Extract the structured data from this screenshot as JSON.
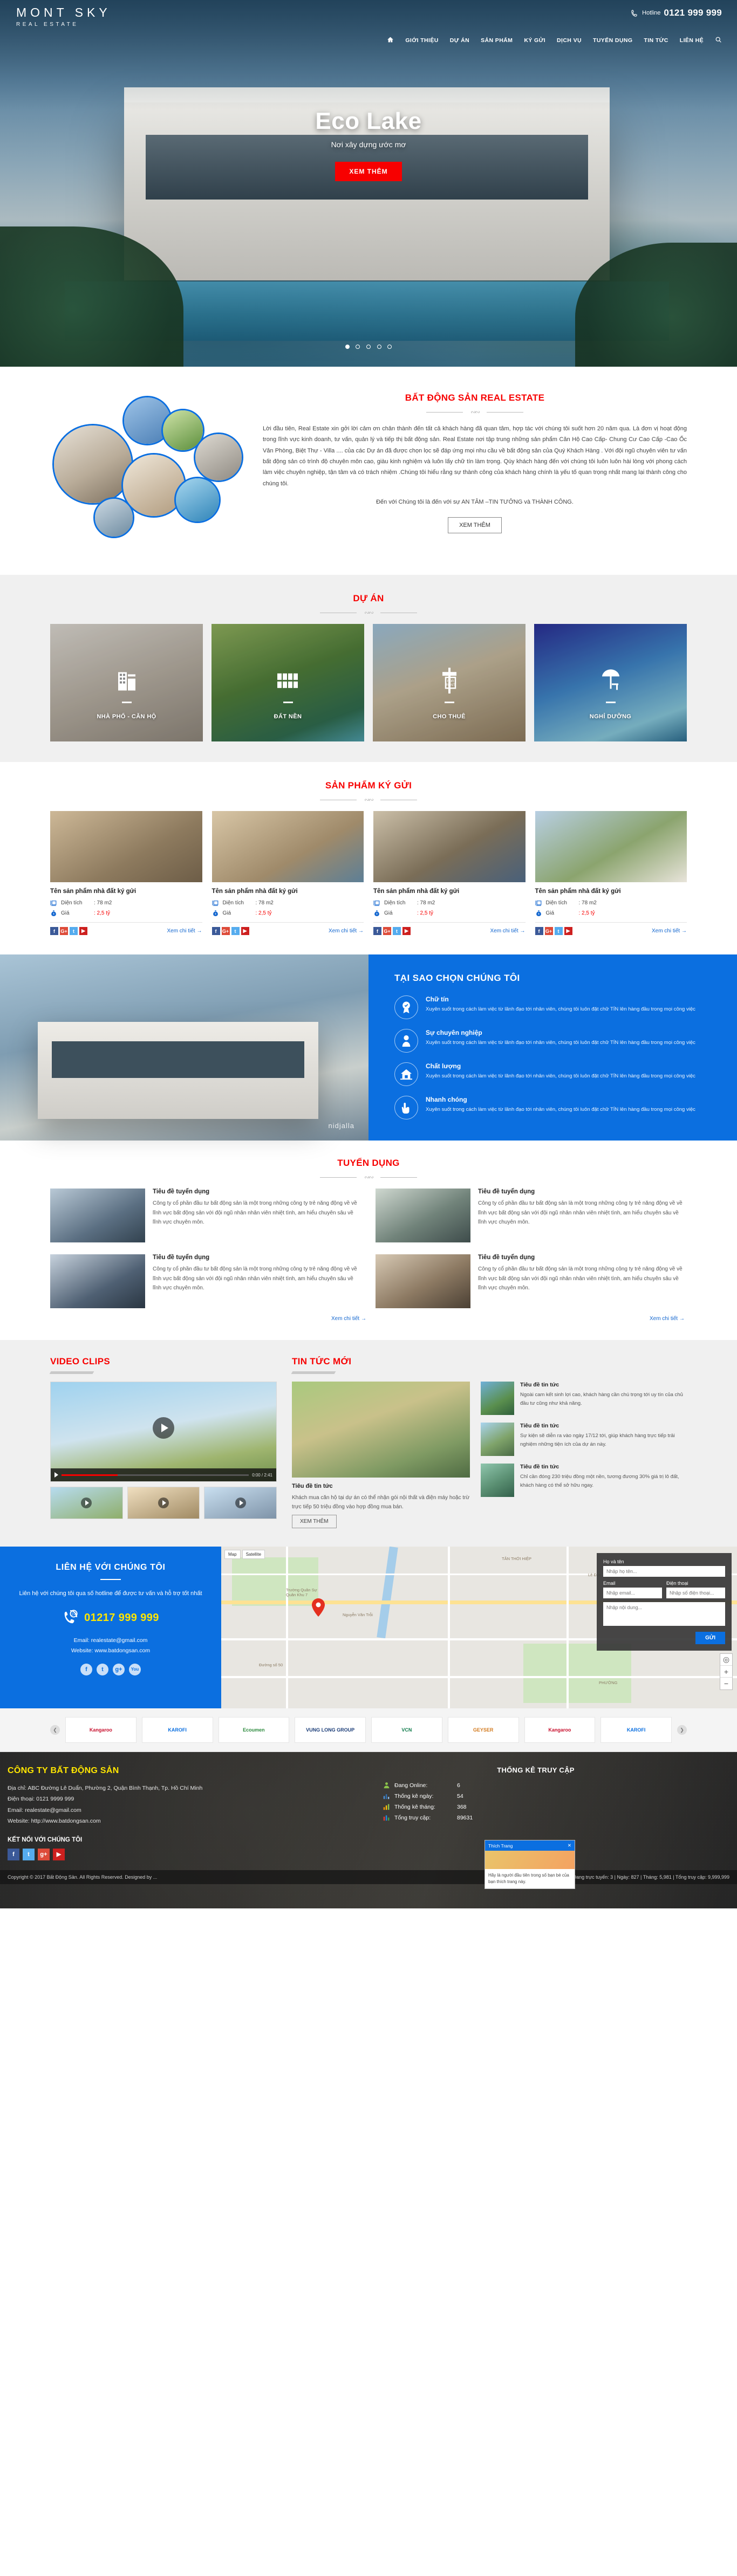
{
  "header": {
    "logo_line1": "MONT SKY",
    "logo_line2": "REAL ESTATE",
    "hotline_label": "Hotline",
    "hotline_number": "0121 999 999",
    "phone_icon": "phone-icon",
    "search_icon": "search-icon",
    "home_icon": "home-icon",
    "nav": [
      {
        "label": "GIỚI THIỆU"
      },
      {
        "label": "DỰ ÁN"
      },
      {
        "label": "SẢN PHẨM"
      },
      {
        "label": "KÝ GỬI"
      },
      {
        "label": "DỊCH VỤ"
      },
      {
        "label": "TUYỂN DỤNG"
      },
      {
        "label": "TIN TỨC"
      },
      {
        "label": "LIÊN HỆ"
      }
    ]
  },
  "hero": {
    "title": "Eco Lake",
    "subtitle": "Nơi xây dựng ước mơ",
    "cta": "XEM THÊM",
    "slide_count": 5,
    "active_slide": 1
  },
  "about": {
    "title": "BẤT ĐỘNG SẢN REAL ESTATE",
    "paragraph": "Lời đầu tiên, Real Estate xin gởi lời cảm ơn chân thành đến tất cả khách hàng đã quan tâm, hợp tác với chúng tôi suốt hơn 20 năm qua. Là đơn vị hoạt động trong lĩnh vực kinh doanh, tư vấn, quản lý và tiếp thị bất động sản. Real Estate nơi tập trung những sản phẩm Căn Hộ Cao Cấp- Chung Cư Cao Cấp -Cao Ốc Văn Phòng, Biệt Thự - Villa .... của các Dự án đã được chọn lọc sẽ đáp ứng mọi nhu cầu về bất động sản của Quý Khách Hàng . Với đội ngũ chuyên viên tư vấn bất động sản có trình độ chuyên môn cao, giàu kinh nghiệm và luôn lấy chữ tín làm trọng. Qúy khách hàng đến với chúng tôi luôn luôn hài lòng với phong cách làm việc chuyên nghiệp, tận tâm và có trách nhiệm .Chúng tôi hiểu rằng sự thành công của khách hàng chính là yếu tố quan trọng nhất mang lại thành công cho chúng tôi.",
    "tagline": "Đến với Chúng tôi là đến với sự AN TÂM –TIN TƯỞNG và THÀNH CÔNG.",
    "cta": "XEM THÊM"
  },
  "projects": {
    "title": "DỰ ÁN",
    "categories": [
      {
        "label": "NHÀ PHỐ - CĂN HỘ",
        "icon": "apartment-icon"
      },
      {
        "label": "ĐẤT NỀN",
        "icon": "land-plots-icon"
      },
      {
        "label": "CHO THUÊ",
        "icon": "for-rent-sign-icon"
      },
      {
        "label": "NGHỈ DƯỠNG",
        "icon": "resort-umbrella-icon"
      }
    ]
  },
  "products": {
    "title": "SẢN PHẨM KÝ GỬI",
    "area_label": "Diện tích",
    "price_label": "Giá",
    "detail_link": "Xem chi tiết →",
    "social_icons": [
      "facebook-icon",
      "google-plus-icon",
      "twitter-icon",
      "youtube-icon"
    ],
    "items": [
      {
        "name": "Tên sản phẩm nhà đất ký gửi",
        "area": ": 78 m2",
        "price": ": 2,5 tỷ"
      },
      {
        "name": "Tên sản phẩm nhà đất ký gửi",
        "area": ": 78 m2",
        "price": ": 2,5 tỷ"
      },
      {
        "name": "Tên sản phẩm nhà đất ký gửi",
        "area": ": 78 m2",
        "price": ": 2,5 tỷ"
      },
      {
        "name": "Tên sản phẩm nhà đất ký gửi",
        "area": ": 78 m2",
        "price": ": 2,5 tỷ"
      }
    ]
  },
  "why_us": {
    "title": "TẠI SAO CHỌN CHÚNG TÔI",
    "image_watermark": "nidjalla",
    "items": [
      {
        "title": "Chữ tín",
        "desc": "Xuyên suốt trong cách làm việc từ lãnh đạo tới nhân viên, chúng tôi luôn đặt chữ TÍN lên hàng đầu trong mọi công việc",
        "icon": "badge-check-icon"
      },
      {
        "title": "Sự chuyên nghiệp",
        "desc": "Xuyên suốt trong cách làm việc từ lãnh đạo tới nhân viên, chúng tôi luôn đặt chữ TÍN lên hàng đầu trong mọi công việc",
        "icon": "businessman-icon"
      },
      {
        "title": "Chất lượng",
        "desc": "Xuyên suốt trong cách làm việc từ lãnh đạo tới nhân viên, chúng tôi luôn đặt chữ TÍN lên hàng đầu trong mọi công việc",
        "icon": "house-quality-icon"
      },
      {
        "title": "Nhanh chóng",
        "desc": "Xuyên suốt trong cách làm việc từ lãnh đạo tới nhân viên, chúng tôi luôn đặt chữ TÍN lên hàng đầu trong mọi công việc",
        "icon": "hand-click-icon"
      }
    ]
  },
  "recruit": {
    "title": "TUYỂN DỤNG",
    "detail_link": "Xem chi tiết →",
    "items": [
      {
        "title": "Tiêu đề tuyển dụng",
        "desc": "Công ty cổ phần đầu tư bất động sản là một trong những công ty trẻ năng động về về lĩnh vực bất động sản với đội ngũ nhân nhân viên nhiệt tình, am hiểu chuyên sâu về lĩnh vực chuyên môn."
      },
      {
        "title": "Tiêu đề tuyển dụng",
        "desc": "Công ty cổ phần đầu tư bất động sản là một trong những công ty trẻ năng động về về lĩnh vực bất động sản với đội ngũ nhân nhân viên nhiệt tình, am hiểu chuyên sâu về lĩnh vực chuyên môn."
      },
      {
        "title": "Tiêu đề tuyển dụng",
        "desc": "Công ty cổ phần đầu tư bất động sản là một trong những công ty trẻ năng động về về lĩnh vực bất động sản với đội ngũ nhân nhân viên nhiệt tình, am hiểu chuyên sâu về lĩnh vực chuyên môn."
      },
      {
        "title": "Tiêu đề tuyển dụng",
        "desc": "Công ty cổ phần đầu tư bất động sản là một trong những công ty trẻ năng động về về lĩnh vực bất động sản với đội ngũ nhân nhân viên nhiệt tình, am hiểu chuyên sâu về lĩnh vực chuyên môn."
      }
    ]
  },
  "videos": {
    "title": "VIDEO CLIPS",
    "current_time": "0:00 / 2:41",
    "play_icon": "play-icon"
  },
  "news": {
    "title": "TIN TỨC MỚI",
    "more_button": "XEM THÊM",
    "featured": {
      "title": "Tiêu đề tin tức",
      "desc": "Khách mua căn hộ tại dự án có thể nhận gói nội thất và điện máy hoặc trừ trực tiếp 50 triệu đồng vào hợp đồng mua bán."
    },
    "items": [
      {
        "title": "Tiêu đề tin tức",
        "desc": "Ngoài cam kết sinh lợi cao, khách hàng cần chú trọng tới uy tín của chủ đầu tư cũng như khả năng."
      },
      {
        "title": "Tiêu đề tin tức",
        "desc": "Sự kiện sẽ diễn ra vào ngày 17/12 tới, giúp khách hàng trực tiếp trải nghiệm những tiện ích của dự án này."
      },
      {
        "title": "Tiêu đề tin tức",
        "desc": "Chỉ cần đóng 230 triệu đồng một nền, tương đương 30% giá trị lô đất, khách hàng có thể sở hữu ngay."
      }
    ]
  },
  "contact": {
    "title": "LIÊN HỆ VỚI CHÚNG TÔI",
    "subtitle": "Liên hệ với chúng tôi qua số hotline để được tư vấn và hỗ trợ tốt nhất",
    "phone": "01217 999 999",
    "phone_icon": "phone-24h-icon",
    "email": "Email: realestate@gmail.com",
    "website": "Website: www.batdongsan.com",
    "social_icons": [
      "facebook-icon",
      "twitter-icon",
      "google-plus-icon",
      "youtube-icon"
    ],
    "map": {
      "layer_map": "Map",
      "layer_satellite": "Satellite",
      "labels": [
        "TÂN THỚI HIỆP",
        "Trường Quân Sự Quân Khu 7",
        "Lê Đức Thọ",
        "Đường số 50",
        "Nguyễn Văn Trỗi",
        "PHƯỜNG"
      ],
      "zoom_in": "+",
      "zoom_out": "−",
      "locate_icon": "locate-icon",
      "pin_icon": "map-pin-icon"
    },
    "form": {
      "name_label": "Họ và tên",
      "name_placeholder": "Nhập họ tên...",
      "email_label": "Email",
      "email_placeholder": "Nhập email...",
      "phone_label": "Điện thoại",
      "phone_placeholder": "Nhập số điện thoại...",
      "message_placeholder": "Nhập nội dung...",
      "submit": "GỬI"
    }
  },
  "partners": {
    "prev_icon": "chevron-left-icon",
    "next_icon": "chevron-right-icon",
    "items": [
      {
        "name": "Kangaroo"
      },
      {
        "name": "KAROFI"
      },
      {
        "name": "Ecoumen"
      },
      {
        "name": "VUNG LONG GROUP"
      },
      {
        "name": "VCN"
      },
      {
        "name": "GEYSER"
      },
      {
        "name": "Kangaroo"
      },
      {
        "name": "KAROFI"
      }
    ]
  },
  "footer": {
    "company": "CÔNG TY BẤT ĐỘNG SẢN",
    "address": "Địa chỉ: ABC Đường Lê Duẩn, Phường 2, Quận Bình Thạnh, Tp. Hồ Chí Minh",
    "phone": "Điện thoại: 0121 9999 999",
    "email": "Email: realestate@gmail.com",
    "website": "Website: http://www.batdongsan.com",
    "connect_title": "KẾT NỐI VỚI CHÚNG TÔI",
    "social_icons": [
      "facebook-icon",
      "twitter-icon",
      "google-plus-icon",
      "youtube-icon"
    ],
    "stats_title": "THỐNG KÊ TRUY CẬP",
    "stats": [
      {
        "label": "Đang Online:",
        "value": "6",
        "icon": "user-online-icon"
      },
      {
        "label": "Thống kê ngày:",
        "value": "54",
        "icon": "day-chart-icon"
      },
      {
        "label": "Thống kê tháng:",
        "value": "368",
        "icon": "month-chart-icon"
      },
      {
        "label": "Tổng truy cập:",
        "value": "89631",
        "icon": "total-chart-icon"
      }
    ],
    "copyright": "Copyright © 2017 Bất Động Sản. All Rights Reserved. Designed by ...",
    "bottom_stats": "Đang trực tuyến: 3  |  Ngày: 827  |  Tháng: 5,981  |  Tổng truy cập: 9,999,999"
  },
  "chat_widget": {
    "title": "Thích Trang",
    "close_icon": "close-icon",
    "text": "Hãy là người đầu tiên trong số bạn bè của bạn thích trang này."
  }
}
